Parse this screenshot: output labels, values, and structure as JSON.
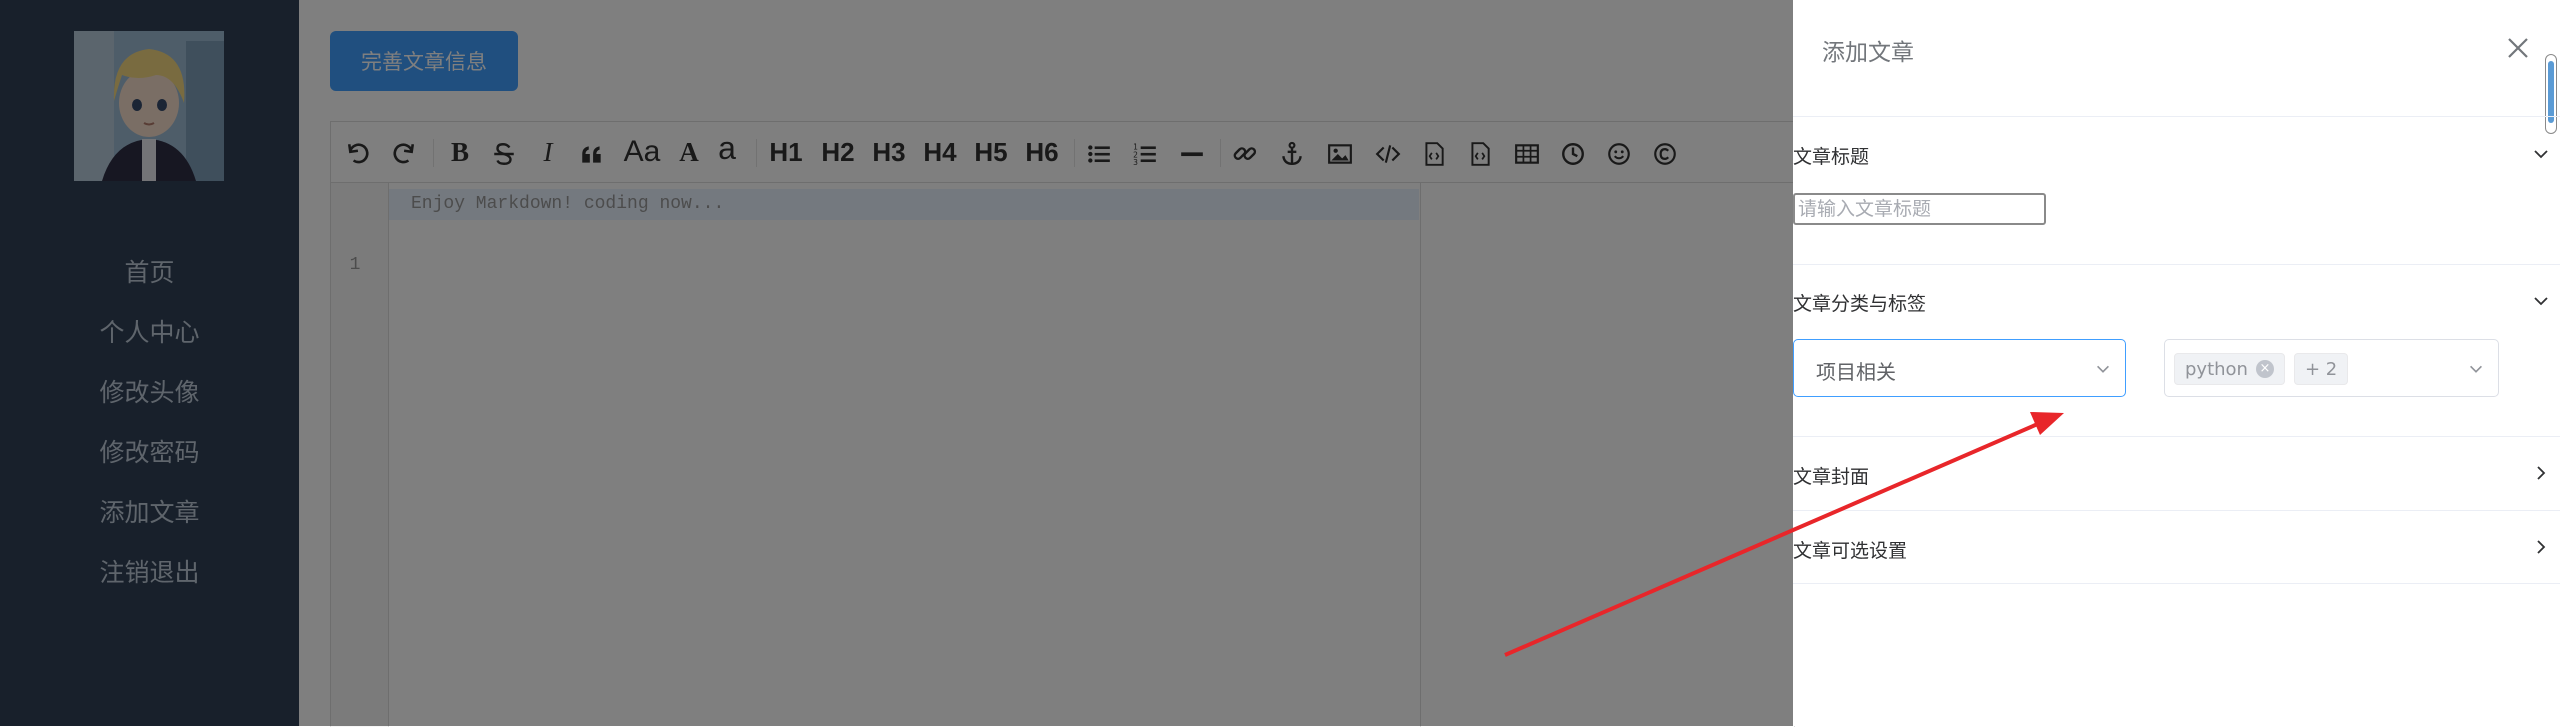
{
  "sidebar": {
    "avatar_alt": "avatar",
    "menu": [
      "首页",
      "个人中心",
      "修改头像",
      "修改密码",
      "添加文章",
      "注销退出"
    ]
  },
  "main": {
    "finish_button": "完善文章信息",
    "toolbar": {
      "aa": "Aa",
      "a_upper": "A",
      "a_lower": "a",
      "headings": [
        "H1",
        "H2",
        "H3",
        "H4",
        "H5",
        "H6"
      ]
    },
    "editor": {
      "line_number": "1",
      "placeholder": "Enjoy Markdown! coding now..."
    }
  },
  "drawer": {
    "title": "添加文章",
    "sections": {
      "title_section": "文章标题",
      "title_placeholder": "请输入文章标题",
      "category_section": "文章分类与标签",
      "category_value": "项目相关",
      "tags": [
        "python"
      ],
      "tag_more": "+ 2",
      "cover_section": "文章封面",
      "options_section": "文章可选设置"
    }
  },
  "colors": {
    "sidebar_bg": "#304156",
    "sidebar_text": "#bfcbd9",
    "primary": "#409eff",
    "annotation_arrow": "#e8262a"
  }
}
